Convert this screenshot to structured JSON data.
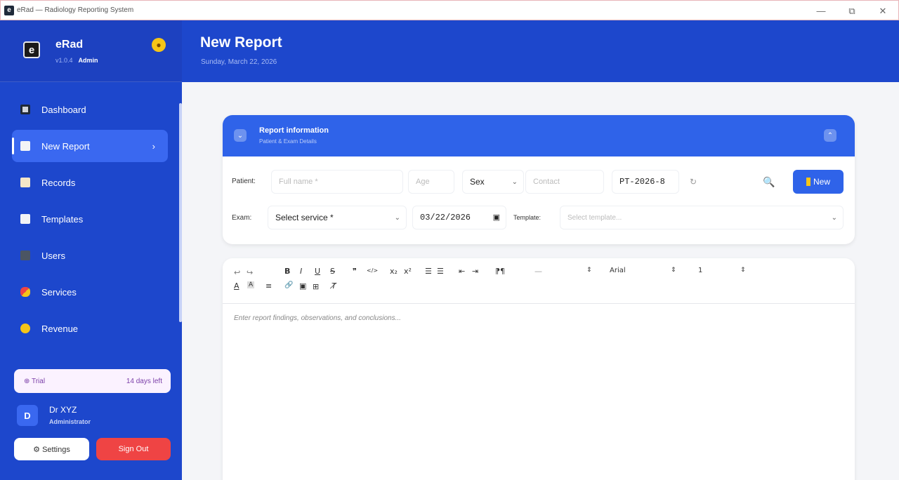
{
  "window": {
    "title": "eRad — Radiology Reporting System",
    "app_icon": "e",
    "minimize": "—",
    "restore": "⧉",
    "close": "✕"
  },
  "brand": {
    "logo": "e",
    "name": "eRad",
    "version": "v1.0.4",
    "role": "Admin",
    "theme_icon": "palette-icon"
  },
  "nav": [
    {
      "label": "Dashboard",
      "icon_color": "#9ca3af"
    },
    {
      "label": "New Report",
      "icon_color": "#f3f4f6",
      "active": true,
      "chevron": "›"
    },
    {
      "label": "Records",
      "icon_color": "#f3e6c8"
    },
    {
      "label": "Templates",
      "icon_color": "#f3f4f6"
    },
    {
      "label": "Users",
      "icon_color": "#6b7280"
    },
    {
      "label": "Services",
      "icon_color": "#ef4444"
    },
    {
      "label": "Revenue",
      "icon_color": "#f5c518"
    }
  ],
  "trial": {
    "label": "⊕ Trial",
    "days": "14 days left"
  },
  "user": {
    "initial": "D",
    "name": "Dr XYZ",
    "role": "Administrator"
  },
  "buttons": {
    "settings": "⚙ Settings",
    "signout": "Sign Out"
  },
  "header": {
    "title": "New Report",
    "date": "Sunday, March 22, 2026"
  },
  "report_info": {
    "title": "Report information",
    "subtitle": "Patient & Exam Details",
    "left_chevron": "⌄",
    "right_chevron": "⌃"
  },
  "patient_row": {
    "label": "Patient:",
    "name_placeholder": "Full name *",
    "age_placeholder": "Age",
    "sex_value": "Sex",
    "contact_placeholder": "Contact",
    "patient_id": "PT-2026-8",
    "refresh_icon": "↻",
    "search_icon": "🔍",
    "new_button": "New"
  },
  "exam_row": {
    "label": "Exam:",
    "service_value": "Select service *",
    "date_value": "03/22/2026",
    "calendar_icon": "▣",
    "template_label": "Template:",
    "template_placeholder": "Select template..."
  },
  "toolbar": {
    "undo": "↩",
    "redo": "↪",
    "bold": "B",
    "italic": "I",
    "underline": "U",
    "strike": "S",
    "quote": "❞",
    "code": "</>",
    "sub": "x₂",
    "sup": "x²",
    "ol": "☰",
    "ul": "☰",
    "outdent": "⇤",
    "indent": "⇥",
    "para": "⁋¶",
    "hr": "—",
    "heading_caret": "⇕",
    "font": "Arial",
    "font_caret": "⇕",
    "size": "1",
    "size_caret": "⇕",
    "font_color": "A",
    "bg_color": "A",
    "align": "≡",
    "link": "🔗",
    "image": "▣",
    "table": "⊞",
    "clear": "T̸"
  },
  "editor": {
    "placeholder": "Enter report findings, observations, and conclusions..."
  }
}
